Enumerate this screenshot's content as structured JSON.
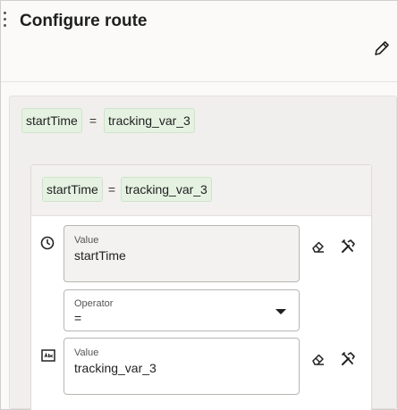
{
  "header": {
    "title": "Configure route",
    "edit_icon": "pencil-icon"
  },
  "outer_summary": {
    "left": "startTime",
    "operator": "=",
    "right": "tracking_var_3"
  },
  "inner_summary": {
    "left": "startTime",
    "operator": "=",
    "right": "tracking_var_3"
  },
  "left_field": {
    "type_icon": "clock-icon",
    "label": "Value",
    "value": "startTime",
    "clear_icon": "eraser-icon",
    "tools_icon": "tools-icon"
  },
  "operator_field": {
    "label": "Operator",
    "value": "="
  },
  "right_field": {
    "type_icon": "text-type-icon",
    "label": "Value",
    "value": "tracking_var_3",
    "clear_icon": "eraser-icon",
    "tools_icon": "tools-icon"
  }
}
